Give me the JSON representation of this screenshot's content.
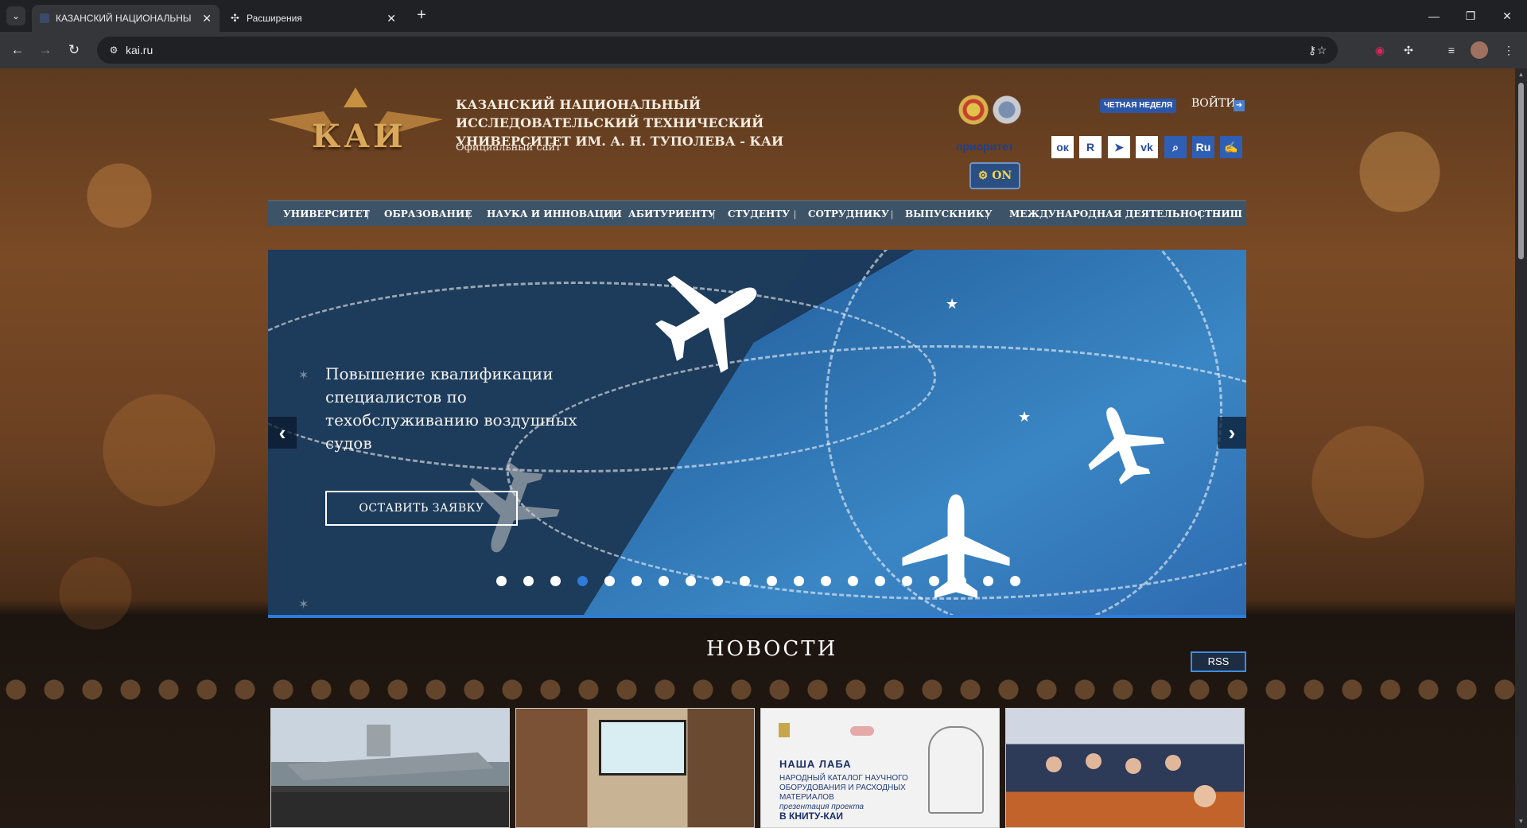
{
  "browser": {
    "tabs": [
      {
        "label": "КАЗАНСКИЙ НАЦИОНАЛЬНЫЙ",
        "active": true
      },
      {
        "label": "Расширения",
        "active": false
      }
    ],
    "url": "kai.ru"
  },
  "header": {
    "logo_text": "КАИ",
    "university_name": "КАЗАНСКИЙ НАЦИОНАЛЬНЫЙ ИССЛЕДОВАТЕЛЬСКИЙ ТЕХНИЧЕСКИЙ УНИВЕРСИТЕТ ИМ. А. Н. ТУПОЛЕВА - КАИ",
    "subtitle": "Официальный сайт",
    "week_badge": "ЧЕТНАЯ НЕДЕЛЯ",
    "login": "ВОЙТИ",
    "priority": "приоритет",
    "language": "Ru",
    "accessibility_toggle": "ON"
  },
  "nav": {
    "items": [
      "УНИВЕРСИТЕТ",
      "ОБРАЗОВАНИЕ",
      "НАУКА И ИННОВАЦИИ",
      "АБИТУРИЕНТУ",
      "СТУДЕНТУ",
      "СОТРУДНИКУ",
      "ВЫПУСКНИКУ",
      "МЕЖДУНАРОДНАЯ ДЕЯТЕЛЬНОСТЬ",
      "ПИШ"
    ],
    "separator": "|"
  },
  "slider": {
    "headline": "Повышение квалификации специалистов по техобслуживанию воздушных судов",
    "cta": "ОСТАВИТЬ ЗАЯВКУ",
    "slide_count": 20,
    "active_slide": 4
  },
  "news": {
    "title": "НОВОСТИ",
    "rss": "RSS",
    "card3": {
      "title": "НАША ЛАБА",
      "subtitle": "НАРОДНЫЙ КАТАЛОГ НАУЧНОГО ОБОРУДОВАНИЯ И РАСХОДНЫХ МАТЕРИАЛОВ",
      "line": "презентация проекта",
      "place": "В КНИТУ-КАИ"
    }
  },
  "colors": {
    "nav_bg": "#3d5368",
    "accent_blue": "#2e7bd8",
    "header_text": "#f5ece0"
  }
}
